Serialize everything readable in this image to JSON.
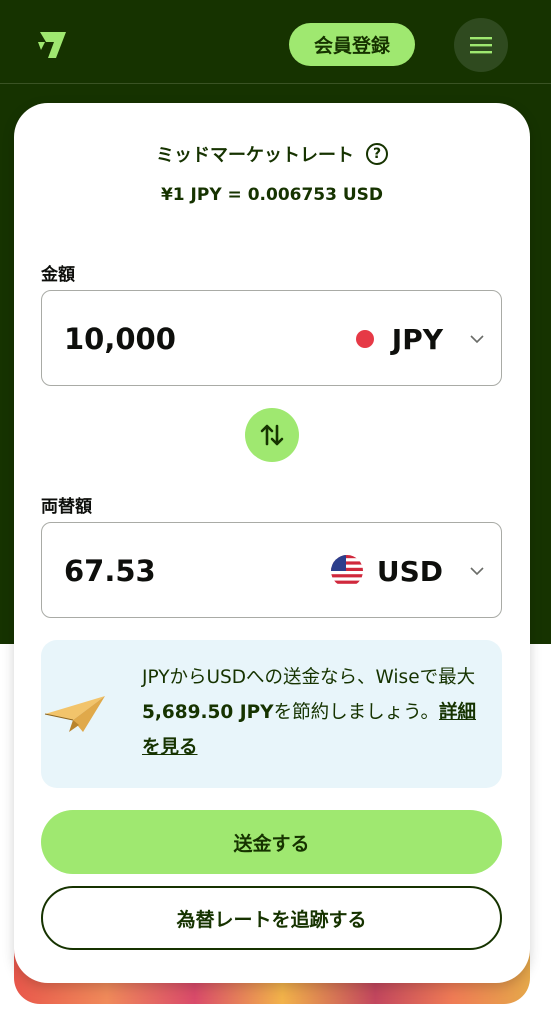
{
  "header": {
    "logo_icon": "wise-flag-logo",
    "signup_label": "会員登録",
    "menu_icon": "hamburger-icon"
  },
  "converter": {
    "rate_title": "ミッドマーケットレート",
    "help_icon": "question-circle-icon",
    "rate_value": "¥1 JPY = 0.006753 USD",
    "amount_label": "金額",
    "amount_value": "10,000",
    "source_currency": "JPY",
    "converted_label": "両替額",
    "converted_value": "67.53",
    "target_currency": "USD",
    "swap_icon": "swap-arrows-icon"
  },
  "promo": {
    "text_before": "JPYからUSDへの送金なら、Wiseで最大",
    "savings_amount": "5,689.50 JPY",
    "text_after": "を節約しましょう。",
    "link_label": "詳細を見る",
    "illustration": "paper-plane-icon"
  },
  "actions": {
    "send_label": "送金する",
    "track_label": "為替レートを追跡する"
  },
  "colors": {
    "brand_dark": "#163300",
    "brand_green": "#9fe870",
    "promo_bg": "#e8f5fa"
  }
}
